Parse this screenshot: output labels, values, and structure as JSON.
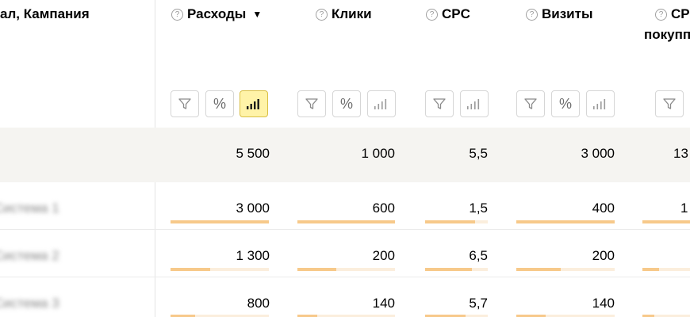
{
  "header": {
    "group_title": "ал, Кампания",
    "columns": [
      {
        "id": "expenses",
        "label": "Расходы",
        "sort": "▼"
      },
      {
        "id": "clicks",
        "label": "Клики"
      },
      {
        "id": "cpc",
        "label": "CPC"
      },
      {
        "id": "visits",
        "label": "Визиты"
      },
      {
        "id": "cpp",
        "label": "CP",
        "label_line2": "покупп"
      }
    ],
    "help_glyph": "?"
  },
  "summary": {
    "expenses": "5 500",
    "clicks": "1 000",
    "cpc": "5,5",
    "visits": "3 000",
    "cpp": "13"
  },
  "rows": [
    {
      "name": "Система 1",
      "expenses": "3 000",
      "clicks": "600",
      "cpc": "1,5",
      "visits": "400",
      "cpp": "1",
      "bars": {
        "expenses": 1.0,
        "clicks": 1.0,
        "cpc": 0.8,
        "visits": 1.0,
        "cpp": 1.0
      }
    },
    {
      "name": "Система 2",
      "expenses": "1 300",
      "clicks": "200",
      "cpc": "6,5",
      "visits": "200",
      "cpp": "",
      "bars": {
        "expenses": 0.4,
        "clicks": 0.4,
        "cpc": 0.75,
        "visits": 0.45,
        "cpp": 0.35
      }
    },
    {
      "name": "Система 3",
      "expenses": "800",
      "clicks": "140",
      "cpc": "5,7",
      "visits": "140",
      "cpp": "",
      "bars": {
        "expenses": 0.25,
        "clicks": 0.2,
        "cpc": 0.65,
        "visits": 0.3,
        "cpp": 0.25
      }
    }
  ],
  "buttons": {
    "filter_icon": "filter-icon",
    "percent_icon": "percent-icon",
    "chart_icon": "bar-chart-icon",
    "percent_glyph": "%"
  },
  "colors": {
    "active_button_bg": "#fff3a8",
    "bar_fill": "#f7c98a",
    "bar_track": "#fbeedd",
    "summary_bg": "#f5f4f1"
  }
}
